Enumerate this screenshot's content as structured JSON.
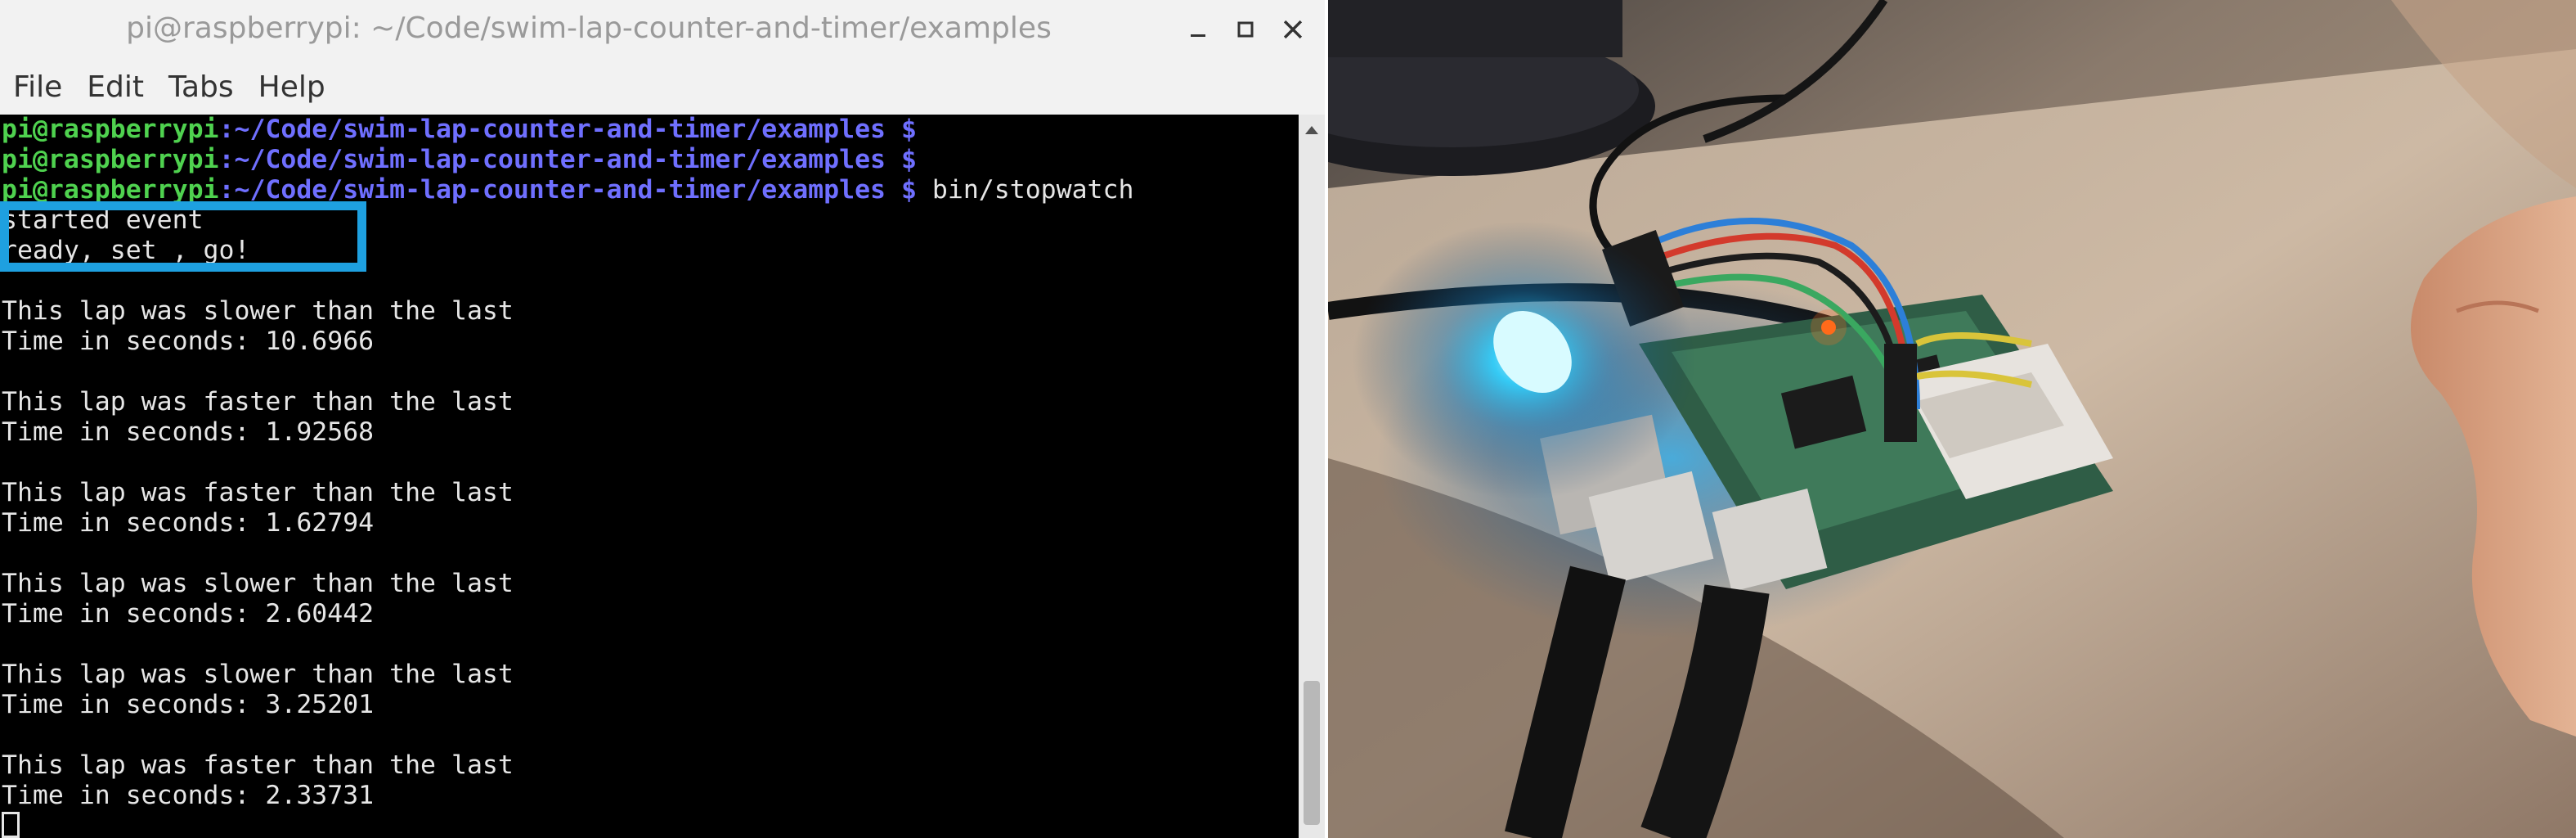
{
  "window": {
    "title": "pi@raspberrypi: ~/Code/swim-lap-counter-and-timer/examples",
    "minimize_icon": "minimize-icon",
    "maximize_icon": "maximize-icon",
    "close_icon": "close-icon"
  },
  "menu": {
    "items": [
      "File",
      "Edit",
      "Tabs",
      "Help"
    ]
  },
  "terminal": {
    "prompts": [
      {
        "user": "pi@raspberrypi",
        "path": ":~/Code/swim-lap-counter-and-timer/examples",
        "dollar": " $",
        "command": ""
      },
      {
        "user": "pi@raspberrypi",
        "path": ":~/Code/swim-lap-counter-and-timer/examples",
        "dollar": " $",
        "command": ""
      },
      {
        "user": "pi@raspberrypi",
        "path": ":~/Code/swim-lap-counter-and-timer/examples",
        "dollar": " $",
        "command": " bin/stopwatch"
      }
    ],
    "output": [
      "started event",
      "ready, set , go!",
      "",
      "This lap was slower than the last",
      "Time in seconds: 10.6966",
      "",
      "This lap was faster than the last",
      "Time in seconds: 1.92568",
      "",
      "This lap was faster than the last",
      "Time in seconds: 1.62794",
      "",
      "This lap was slower than the last",
      "Time in seconds: 2.60442",
      "",
      "This lap was slower than the last",
      "Time in seconds: 3.25201",
      "",
      "This lap was faster than the last",
      "Time in seconds: 2.33731"
    ]
  },
  "colors": {
    "highlight_box": "#1ea0e0",
    "prompt_user": "#4fd24f",
    "prompt_path": "#6f6fff",
    "led_glow": "#1fc8ff",
    "led_indicator": "#ff6a1a"
  },
  "photo": {
    "subject": "raspberry-pi-with-blue-led-photo"
  }
}
